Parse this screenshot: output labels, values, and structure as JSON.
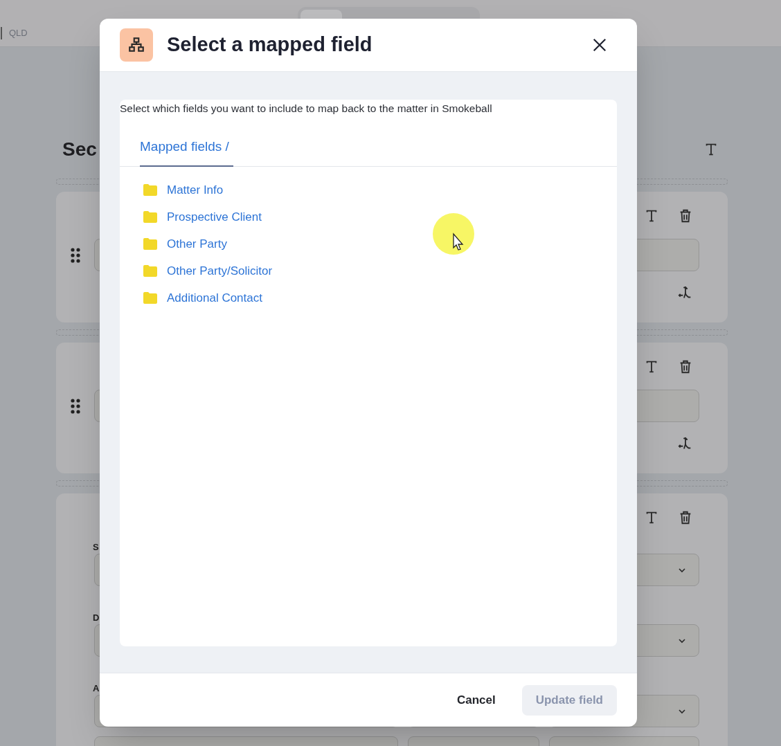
{
  "page": {
    "region_label": "QLD",
    "section_heading": "Sec",
    "cards": [
      {
        "kind": "input"
      },
      {
        "kind": "input"
      },
      {
        "kind": "selects",
        "field_labels": [
          "S",
          "D",
          "A"
        ]
      }
    ]
  },
  "modal": {
    "title": "Select a mapped field",
    "description": "Select which fields you want to include to map back to the matter in Smokeball",
    "breadcrumbs": [
      {
        "label": "Mapped fields /",
        "selected": true
      }
    ],
    "folders": [
      "Matter Info",
      "Prospective Client",
      "Other Party",
      "Other Party/Solicitor",
      "Additional Contact"
    ],
    "buttons": [
      {
        "label": "Cancel",
        "kind": "text",
        "disabled": false
      },
      {
        "label": "Update field",
        "kind": "primary",
        "disabled": true
      }
    ]
  }
}
